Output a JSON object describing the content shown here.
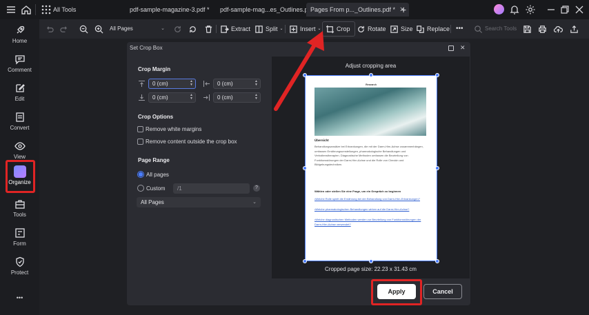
{
  "titlebar": {
    "all_tools": "All Tools",
    "tabs": [
      {
        "label": "pdf-sample-magazine-3.pdf *",
        "close": ""
      },
      {
        "label": "pdf-sample-mag...es_Outlines.pdf *",
        "close": ""
      },
      {
        "label": "Pages From p..._Outlines.pdf *",
        "close": "✕"
      }
    ],
    "new_tab": "+"
  },
  "sidebar": {
    "items": [
      {
        "label": "Home",
        "icon": "rocket-icon"
      },
      {
        "label": "Comment",
        "icon": "comment-icon"
      },
      {
        "label": "Edit",
        "icon": "edit-icon"
      },
      {
        "label": "Convert",
        "icon": "convert-icon"
      },
      {
        "label": "View",
        "icon": "eye-icon"
      },
      {
        "label": "Organize",
        "icon": "organize-icon"
      },
      {
        "label": "Tools",
        "icon": "toolbox-icon"
      },
      {
        "label": "Form",
        "icon": "form-icon"
      },
      {
        "label": "Protect",
        "icon": "shield-icon"
      }
    ],
    "more": "•••"
  },
  "toolbar": {
    "pages_select": "All Pages",
    "extract": "Extract",
    "split": "Split",
    "insert": "Insert",
    "crop": "Crop",
    "rotate": "Rotate",
    "size": "Size",
    "replace": "Replace",
    "more": "•••",
    "search_placeholder": "Search Tools"
  },
  "dialog": {
    "title": "Set Crop Box",
    "crop_margin_label": "Crop Margin",
    "margins": {
      "top": "0 (cm)",
      "left": "0 (cm)",
      "bottom": "0 (cm)",
      "right": "0 (cm)"
    },
    "crop_options_label": "Crop Options",
    "option_remove_white": "Remove white margins",
    "option_remove_outside": "Remove content outside the crop box",
    "page_range_label": "Page Range",
    "radio_all_pages": "All pages",
    "radio_custom": "Custom",
    "custom_placeholder": "/1",
    "help": "?",
    "range_select": "All Pages",
    "adjust_label": "Adjust cropping area",
    "cropped_size": "Cropped page size: 22.23 x 31.43 cm",
    "apply": "Apply",
    "cancel": "Cancel"
  },
  "document": {
    "title": "Research",
    "heading": "Übersicht",
    "body": "Behandlungsansätze bei Erkrankungen, die mit der Darm-Hirn-Achse zusammenhängen, umfassen Ernährungsumstellungen, pharmakologische Behandlungen und Verhaltenstherapien. Diagnostische Methoden umfassen die Beurteilung von Funktionsstörungen der Darm-Hirn-Achse und die Rolle von Checkin und Bildgebungstechniken.",
    "prompt": "Wählen oder stellen Sie eine Frage, um ein Gespräch zu beginnen",
    "links": [
      "•Welche Rolle spielt die Ernährung bei der Behandlung von Darm-Hirn-Erkrankungen?",
      "•Welche pharmakologischen Behandlungen wirken auf die Darm-Hirn-Achse?",
      "•Welche diagnostischen Methoden werden zur Beurteilung von Funktionsstörungen der Darm-Hirn-Achse verwendet?"
    ]
  },
  "colors": {
    "accent": "#4a7dff",
    "annotation": "#e02424"
  }
}
